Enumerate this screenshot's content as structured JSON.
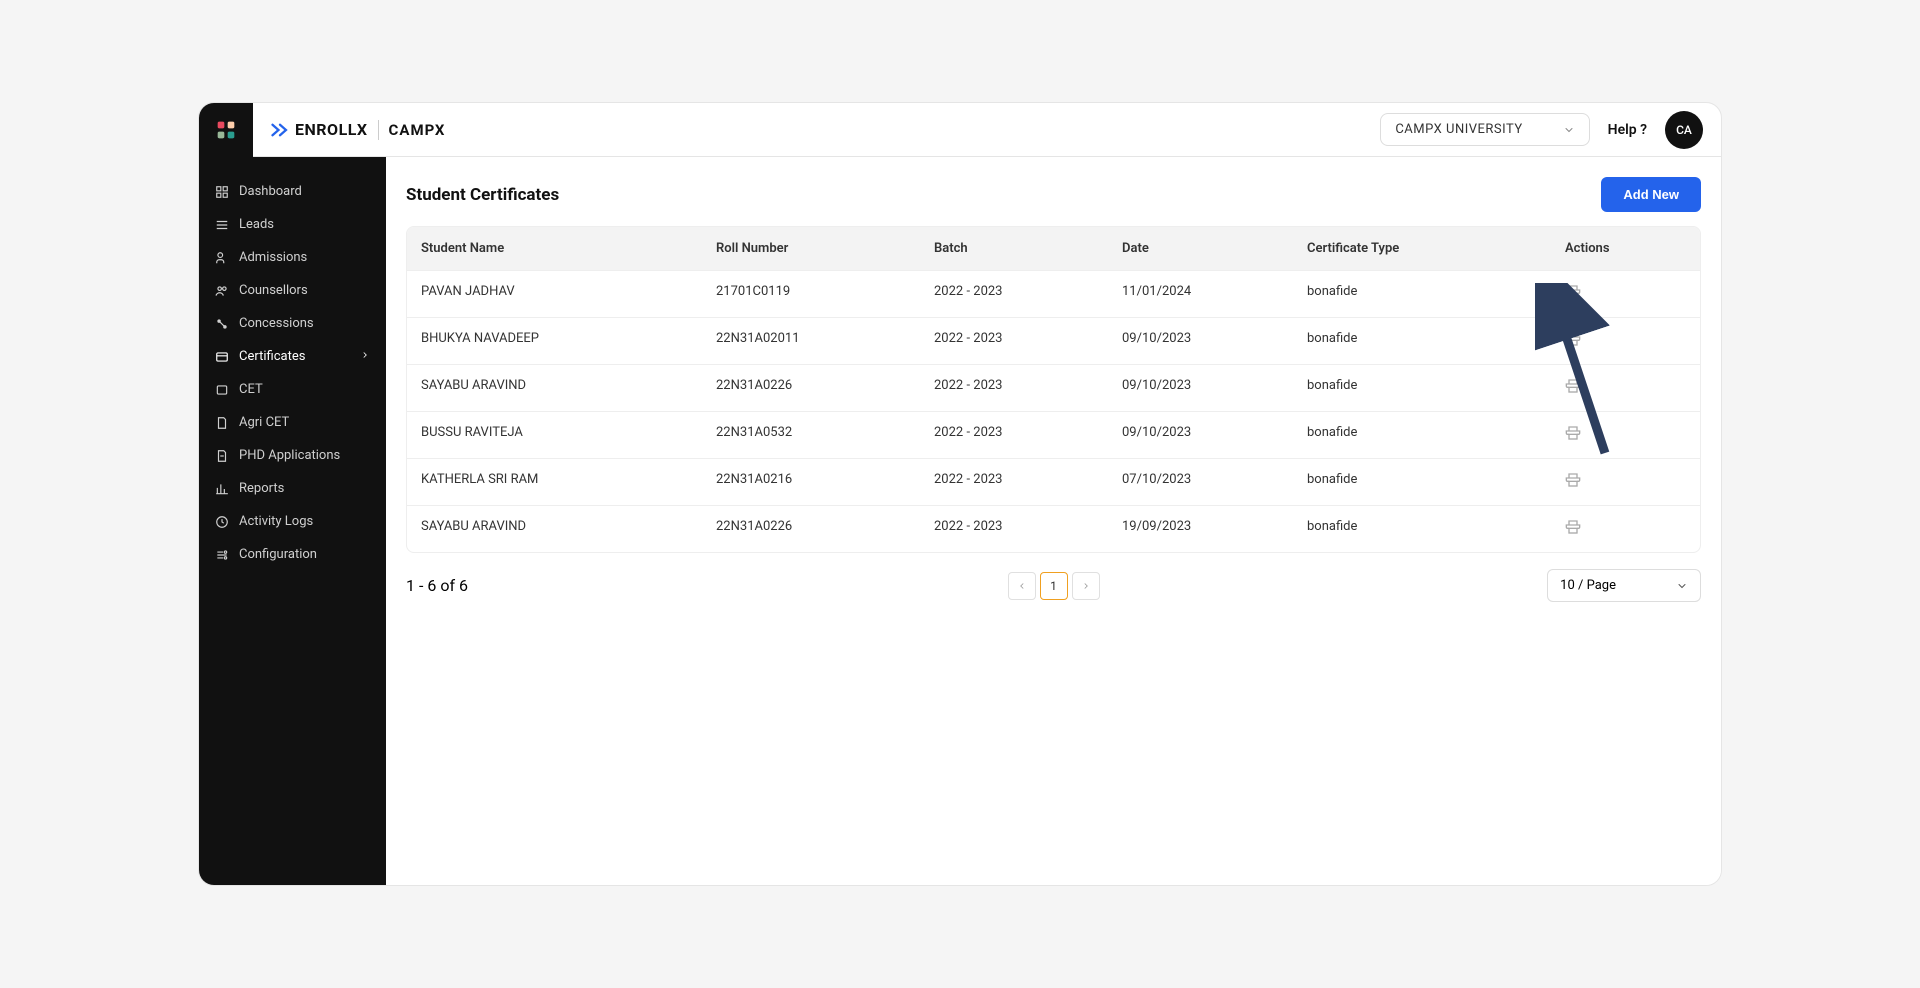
{
  "header": {
    "brand_enrollx": "ENROLLX",
    "brand_campx": "CAMPX",
    "university_label": "CAMPX UNIVERSITY",
    "help_label": "Help ?",
    "avatar_initials": "CA"
  },
  "sidebar": {
    "items": [
      {
        "label": "Dashboard",
        "icon": "dashboard"
      },
      {
        "label": "Leads",
        "icon": "leads"
      },
      {
        "label": "Admissions",
        "icon": "admissions"
      },
      {
        "label": "Counsellors",
        "icon": "counsellors"
      },
      {
        "label": "Concessions",
        "icon": "concessions"
      },
      {
        "label": "Certificates",
        "icon": "certificates",
        "expandable": true
      },
      {
        "label": "CET",
        "icon": "cet"
      },
      {
        "label": "Agri CET",
        "icon": "agricet"
      },
      {
        "label": "PHD Applications",
        "icon": "phd"
      },
      {
        "label": "Reports",
        "icon": "reports"
      },
      {
        "label": "Activity Logs",
        "icon": "activity"
      },
      {
        "label": "Configuration",
        "icon": "config"
      }
    ]
  },
  "main": {
    "title": "Student Certificates",
    "add_new_label": "Add New",
    "columns": {
      "name": "Student Name",
      "roll": "Roll Number",
      "batch": "Batch",
      "date": "Date",
      "type": "Certificate Type",
      "actions": "Actions"
    },
    "rows": [
      {
        "name": "PAVAN JADHAV",
        "roll": "21701C0119",
        "batch": "2022 - 2023",
        "date": "11/01/2024",
        "type": "bonafide"
      },
      {
        "name": "BHUKYA NAVADEEP",
        "roll": "22N31A02011",
        "batch": "2022 - 2023",
        "date": "09/10/2023",
        "type": "bonafide"
      },
      {
        "name": "SAYABU ARAVIND",
        "roll": "22N31A0226",
        "batch": "2022 - 2023",
        "date": "09/10/2023",
        "type": "bonafide"
      },
      {
        "name": "BUSSU RAVITEJA",
        "roll": "22N31A0532",
        "batch": "2022 - 2023",
        "date": "09/10/2023",
        "type": "bonafide"
      },
      {
        "name": "KATHERLA SRI RAM",
        "roll": "22N31A0216",
        "batch": "2022 - 2023",
        "date": "07/10/2023",
        "type": "bonafide"
      },
      {
        "name": "SAYABU ARAVIND",
        "roll": "22N31A0226",
        "batch": "2022 - 2023",
        "date": "19/09/2023",
        "type": "bonafide"
      }
    ],
    "pagination": {
      "summary": "1 - 6 of 6",
      "current_page": "1",
      "page_size_label": "10 / Page"
    }
  }
}
